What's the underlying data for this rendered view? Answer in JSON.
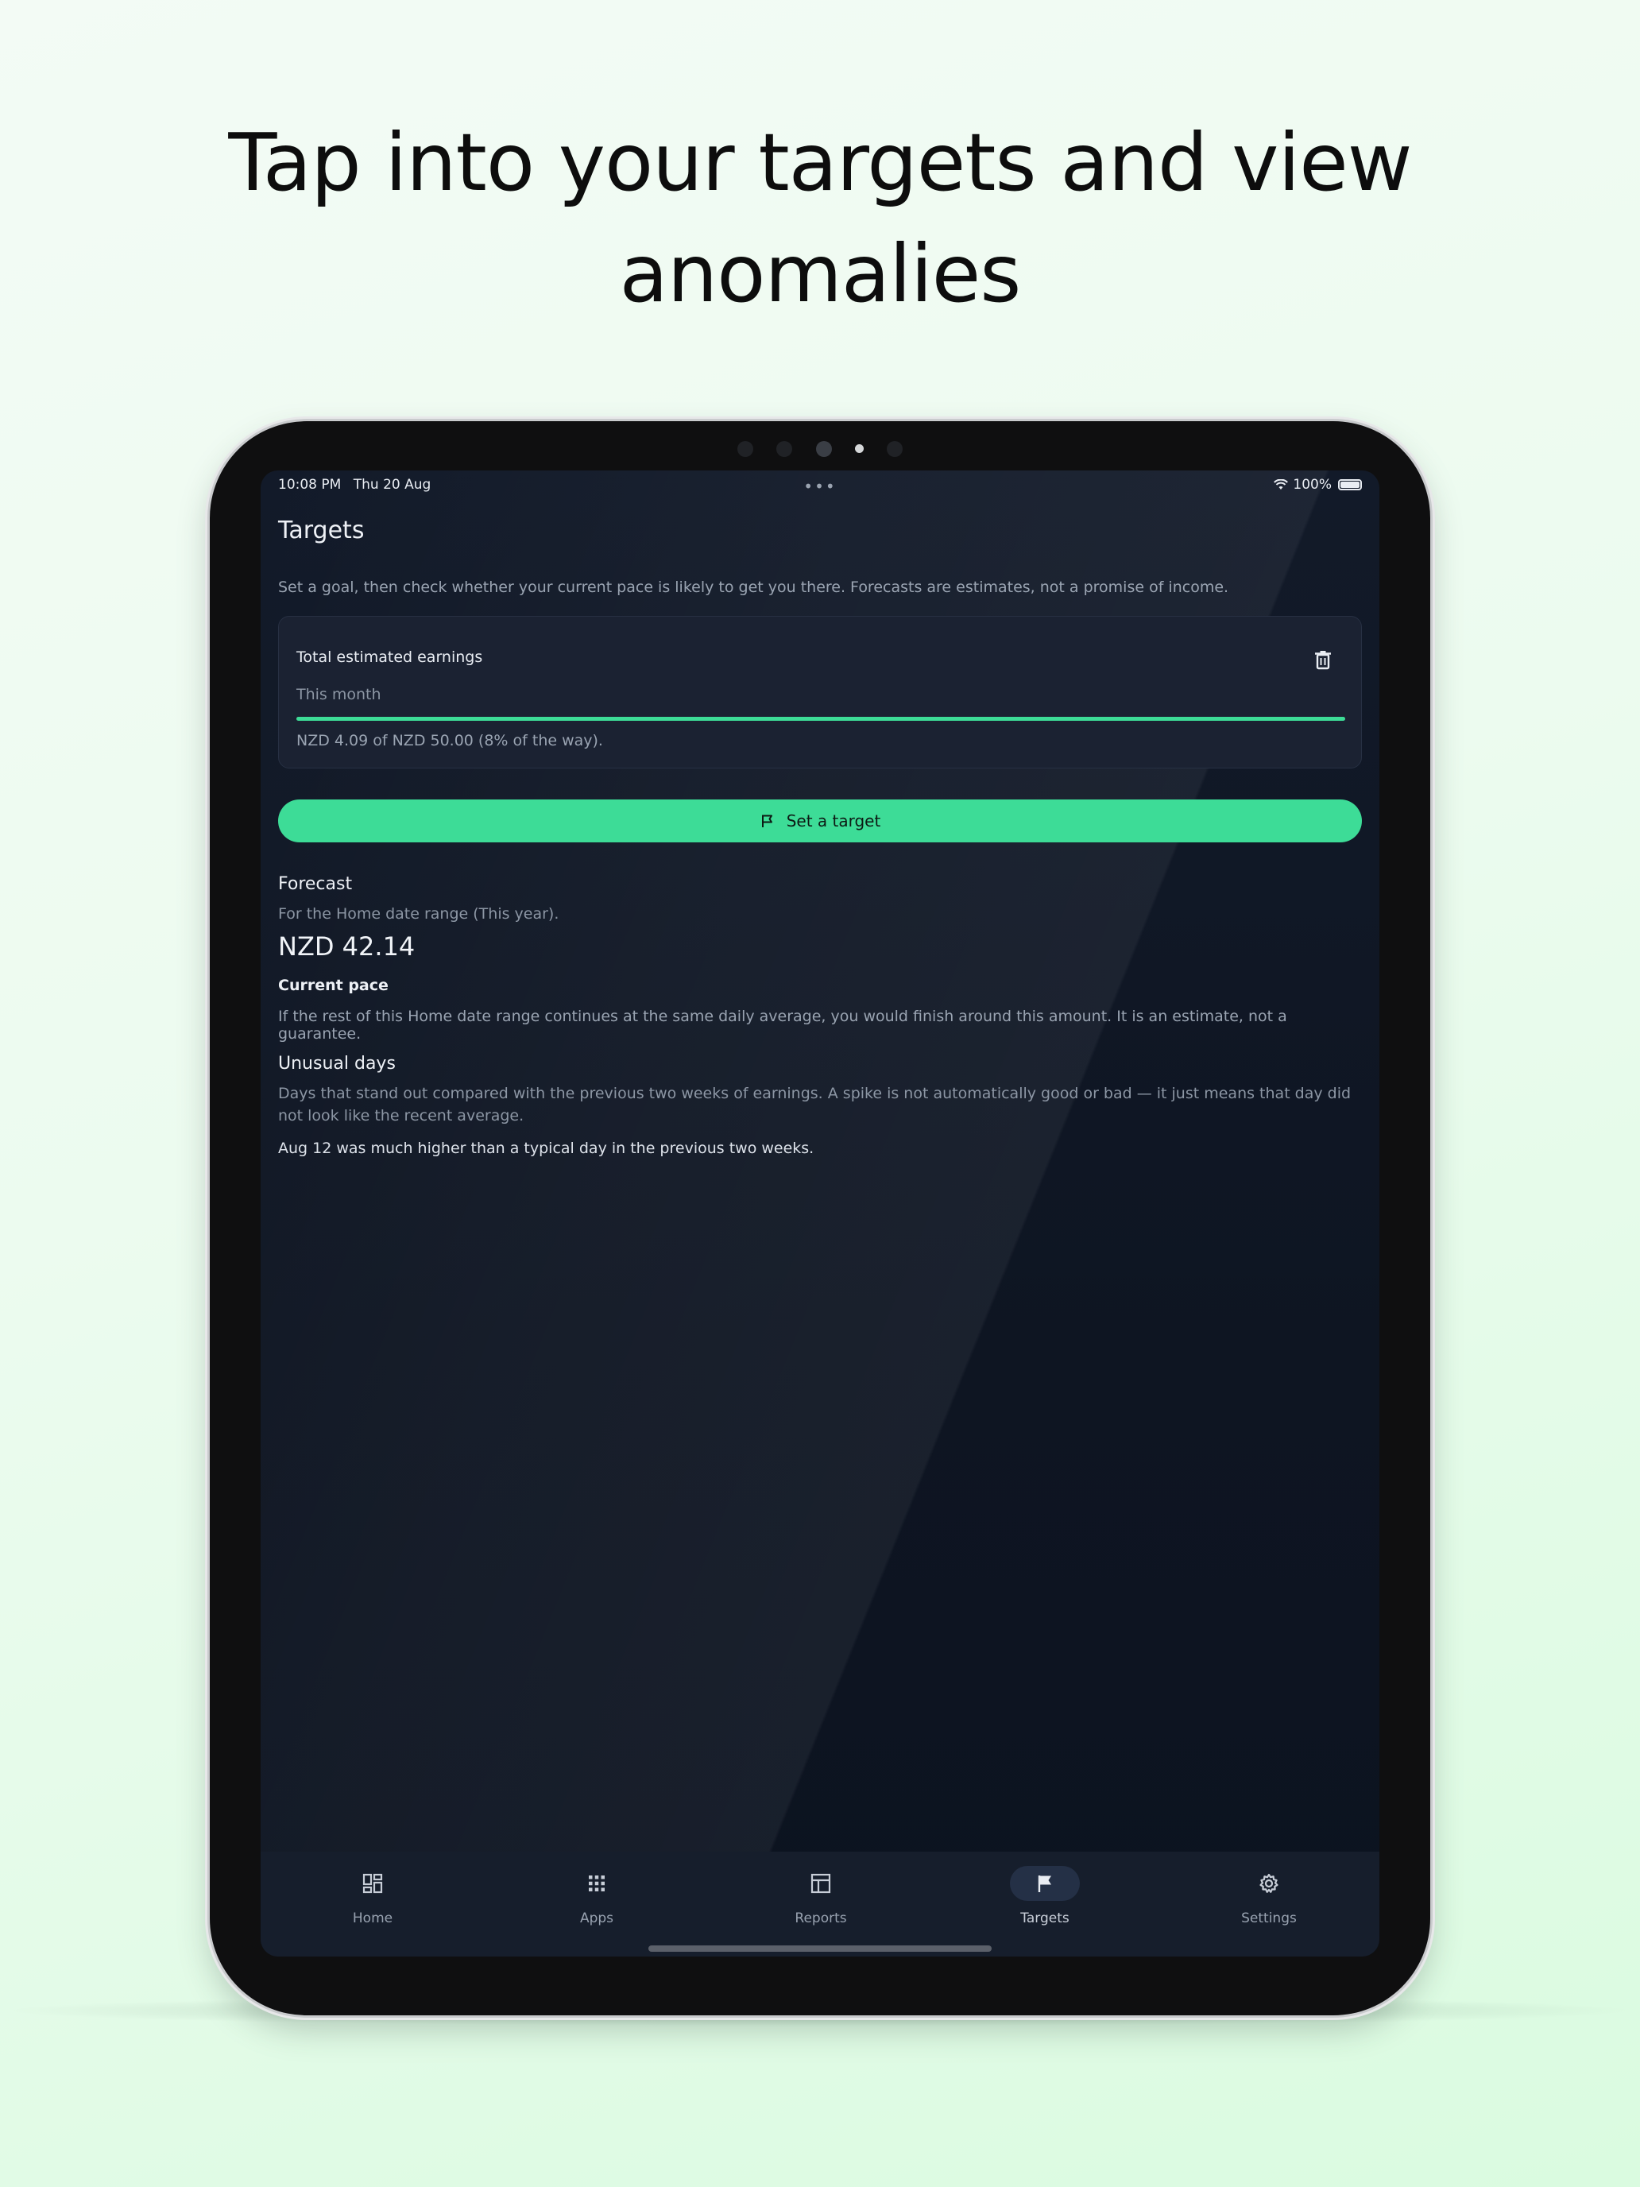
{
  "headline": {
    "line1": "Tap into your targets and view",
    "line2": "anomalies"
  },
  "status_bar": {
    "time": "10:08 PM",
    "date": "Thu 20 Aug",
    "battery": "100%"
  },
  "page": {
    "title": "Targets",
    "intro": "Set a goal, then check whether your current pace is likely to get you there. Forecasts are estimates, not a promise of income."
  },
  "target_card": {
    "title": "Total estimated earnings",
    "period": "This month",
    "summary": "NZD 4.09 of NZD 50.00 (8% of the way).",
    "progress_percent": 8,
    "delete_icon": "trash-icon"
  },
  "cta": {
    "label": "Set a target",
    "icon": "flag-outline-icon"
  },
  "forecast": {
    "heading": "Forecast",
    "subtitle": "For the Home date range (This year).",
    "value": "NZD 42.14",
    "pace_label": "Current pace",
    "description": "If the rest of this Home date range continues at the same daily average, you would finish around this amount. It is an estimate, not a guarantee."
  },
  "unusual_days": {
    "heading": "Unusual days",
    "description": "Days that stand out compared with the previous two weeks of earnings. A spike is not automatically good or bad — it just means that day did not look like the recent average.",
    "items": [
      "Aug 12 was much higher than a typical day in the previous two weeks."
    ]
  },
  "nav": {
    "items": [
      {
        "label": "Home",
        "icon": "dashboard-icon"
      },
      {
        "label": "Apps",
        "icon": "apps-grid-icon"
      },
      {
        "label": "Reports",
        "icon": "table-icon"
      },
      {
        "label": "Targets",
        "icon": "flag-icon",
        "active": true
      },
      {
        "label": "Settings",
        "icon": "gear-icon"
      }
    ]
  },
  "colors": {
    "accent": "#3ddc97",
    "background": "#0e1522",
    "card": "#1b2232"
  }
}
